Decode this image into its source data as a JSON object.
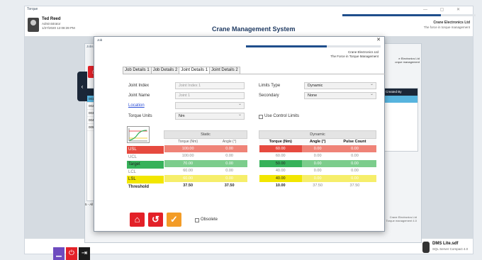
{
  "window": {
    "title": "Torque",
    "controls": "—  ▢  ✕",
    "user": {
      "name": "Ted Reed",
      "role": "Administrator",
      "timestamp": "1/27/2020 12:08:39 PM"
    },
    "app_title": "Crane Management System",
    "brand": {
      "name": "Crane Electronics Ltd",
      "tagline": "The force in torque management"
    }
  },
  "background_panel": {
    "title": "Jobs",
    "list_rows": [
      "001",
      "002",
      "003",
      "004",
      "005"
    ],
    "right_header": "Created By",
    "right_brand": {
      "name": "e Electronics Ltd",
      "tagline": "orque management"
    },
    "status": "5 - All records dis",
    "current_label": "Current",
    "footer_brand": {
      "name": "Crane Electronics Ltd",
      "tagline": "Torque management 4.0"
    }
  },
  "dialog": {
    "title": "Job",
    "close": "✕",
    "brand": {
      "name": "Crane Electronics Ltd",
      "tagline": "The Force in Torque Management"
    },
    "tabs": [
      "Job Details 1",
      "Job Details 2",
      "Joint Details 1",
      "Joint Details 2"
    ],
    "active_tab": 2,
    "form": {
      "joint_index_label": "Joint Index",
      "joint_index_value": "Joint Index 1",
      "joint_name_label": "Joint Name",
      "joint_name_value": "Joint 1",
      "location_label": "Location",
      "location_value": "",
      "torque_units_label": "Torque Units",
      "torque_units_value": "Nm",
      "limits_type_label": "Limits Type",
      "limits_type_value": "Dynamic",
      "secondary_label": "Secondary",
      "secondary_value": "None",
      "use_control_limits_label": "Use Control Limits"
    },
    "table": {
      "static_group": "Static",
      "dynamic_group": "Dynamic",
      "static_headers": [
        "Torque (Nm)",
        "Angle (°)"
      ],
      "dynamic_headers": [
        "Torque (Nm)",
        "Angle (°)",
        "Pulse Count"
      ],
      "rows": [
        {
          "label": "USL",
          "cls": "usl",
          "s_torque": "100.00",
          "s_angle": "0.00",
          "d_torque": "60.00",
          "d_angle": "0.00",
          "d_pulse": "0.00"
        },
        {
          "label": "UCL",
          "cls": "ucl",
          "s_torque": "100.00",
          "s_angle": "0.00",
          "d_torque": "60.00",
          "d_angle": "0.00",
          "d_pulse": "0.00"
        },
        {
          "label": "Target",
          "cls": "tgt",
          "s_torque": "70.00",
          "s_angle": "0.00",
          "d_torque": "50.00",
          "d_angle": "0.00",
          "d_pulse": "0.00"
        },
        {
          "label": "LCL",
          "cls": "lcl",
          "s_torque": "60.00",
          "s_angle": "0.00",
          "d_torque": "40.00",
          "d_angle": "0.00",
          "d_pulse": "0.00"
        },
        {
          "label": "LSL",
          "cls": "lsl",
          "s_torque": "60.00",
          "s_angle": "0.00",
          "d_torque": "40.00",
          "d_angle": "0.00",
          "d_pulse": "0.00"
        },
        {
          "label": "Threshold",
          "cls": "thr",
          "s_torque": "37.50",
          "s_angle": "37.50",
          "d_torque": "10.00",
          "d_angle": "37.50",
          "d_pulse": "37.50"
        }
      ]
    },
    "obsolete_label": "Obsolete"
  },
  "footer": {
    "db_name": "DMS Lite.sdf",
    "db_sub": "SQL Server Compact 4.0"
  },
  "colors": {
    "navy": "#1f3a62",
    "red": "#e32128",
    "purple": "#6a3fb5",
    "orange": "#f39c27",
    "selected": "#57b4de"
  }
}
